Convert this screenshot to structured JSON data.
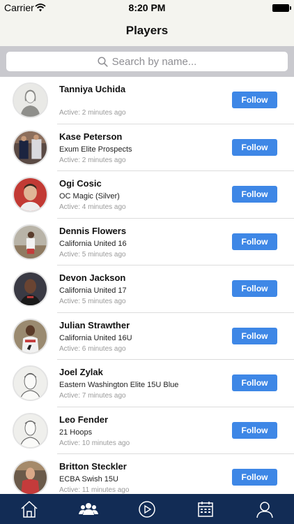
{
  "status_bar": {
    "carrier": "Carrier",
    "time": "8:20 PM"
  },
  "nav": {
    "title": "Players"
  },
  "search": {
    "placeholder": "Search by name..."
  },
  "players": [
    {
      "name": "Tanniya Uchida",
      "team": "",
      "active": "Active: 2 minutes ago",
      "follow_label": "Follow"
    },
    {
      "name": "Kase Peterson",
      "team": "Exum Elite Prospects",
      "active": "Active: 2 minutes ago",
      "follow_label": "Follow"
    },
    {
      "name": "Ogi Cosic",
      "team": "OC Magic (Silver)",
      "active": "Active: 4 minutes ago",
      "follow_label": "Follow"
    },
    {
      "name": "Dennis Flowers",
      "team": "California United 16",
      "active": "Active: 5 minutes ago",
      "follow_label": "Follow"
    },
    {
      "name": "Devon Jackson",
      "team": "California United 17",
      "active": "Active: 5 minutes ago",
      "follow_label": "Follow"
    },
    {
      "name": "Julian Strawther",
      "team": "California United 16U",
      "active": "Active: 6 minutes ago",
      "follow_label": "Follow"
    },
    {
      "name": "Joel Zylak",
      "team": "Eastern Washington Elite 15U Blue",
      "active": "Active: 7 minutes ago",
      "follow_label": "Follow"
    },
    {
      "name": "Leo Fender",
      "team": "21 Hoops",
      "active": "Active: 10 minutes ago",
      "follow_label": "Follow"
    },
    {
      "name": "Britton Steckler",
      "team": "ECBA Swish 15U",
      "active": "Active: 11 minutes ago",
      "follow_label": "Follow"
    }
  ],
  "tab_bar": {
    "tabs": [
      {
        "icon": "home-icon",
        "selected": false
      },
      {
        "icon": "people-icon",
        "selected": true
      },
      {
        "icon": "play-icon",
        "selected": false
      },
      {
        "icon": "calendar-icon",
        "selected": false
      },
      {
        "icon": "profile-icon",
        "selected": false
      }
    ]
  },
  "colors": {
    "follow_button": "#3e87e6",
    "tab_bar": "#122c55",
    "nav_background": "#f4f4ef",
    "search_bar_background": "#c9c9ce"
  }
}
